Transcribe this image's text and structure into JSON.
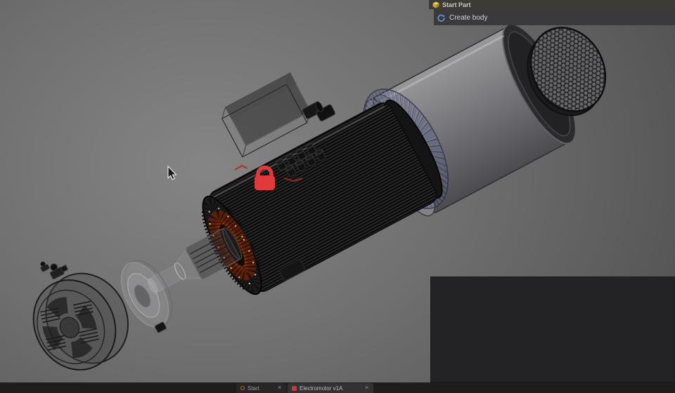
{
  "history_panel": {
    "items": [
      {
        "label": "Start Part",
        "icon": "cube-icon"
      },
      {
        "label": "Create body",
        "icon": "body-icon"
      }
    ]
  },
  "document_tabs": {
    "close_glyph": "✕",
    "items": [
      {
        "label": "Start",
        "active": false
      },
      {
        "label": "Electromotor v1A",
        "active": true
      }
    ]
  },
  "viewport": {
    "lock_color": "#e03a3c",
    "copper_winding_color": "#c25617",
    "fan_blade_color": "#5a6aa0",
    "housing_color": "#88888c",
    "wireframe_color": "#141414",
    "background_center": "#858585",
    "background_edge": "#454545"
  }
}
